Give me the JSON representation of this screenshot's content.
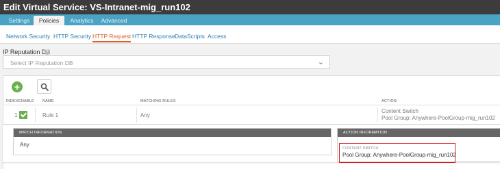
{
  "window": {
    "title": "Edit Virtual Service: VS-Intranet-mig_run102"
  },
  "tabs": [
    {
      "label": "Settings"
    },
    {
      "label": "Policies"
    },
    {
      "label": "Analytics"
    },
    {
      "label": "Advanced"
    }
  ],
  "subtabs": [
    {
      "label": "Network Security"
    },
    {
      "label": "HTTP Security"
    },
    {
      "label": "HTTP Request"
    },
    {
      "label": "HTTP Response"
    },
    {
      "label": "DataScripts"
    },
    {
      "label": "Access"
    }
  ],
  "ip_reputation": {
    "label": "IP Reputation DB",
    "help_icon": "?",
    "placeholder": "Select IP Reputation DB"
  },
  "toolbar": {
    "add_icon": "+"
  },
  "table": {
    "headers": {
      "index": "INDEX",
      "enable": "ENABLE",
      "name": "NAME",
      "matching_rules": "MATCHING RULES",
      "action": "ACTION"
    },
    "rows": [
      {
        "index": "1",
        "enabled": true,
        "name": "Rule 1",
        "matching_rules": "Any",
        "action_line1": "Content Switch",
        "action_line2": "Pool Group: Anywhere-PoolGroup-mig_run102"
      }
    ]
  },
  "detail": {
    "match_header": "MATCH INFORMATION",
    "match_value": "Any",
    "action_header": "ACTION INFORMATION",
    "content_switch_label": "CONTENT SWITCH",
    "content_switch_value": "Pool Group: Anywhere-PoolGroup-mig_run102"
  },
  "colors": {
    "accent": "#e05a2a",
    "link": "#2b7fb0",
    "tab_bar": "#4aa3c4",
    "success": "#6ab04c",
    "highlight_border": "#d42020"
  }
}
